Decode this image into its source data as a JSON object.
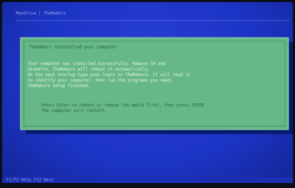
{
  "window": {
    "title": "Mandriva | TheMakers"
  },
  "colors": {
    "screen_background": "#1c34c4",
    "dialog_background": "#67b889",
    "dialog_text": "#215f40",
    "highlight_text": "#eef6e8"
  },
  "dialog": {
    "title": "TheMakers reinstalled your computer",
    "lines": [
      "Your computer was installed successfully. Remove CD and",
      "diskette, TheMakers will reboot it automatically.",
      "On the next startup type your login in TheMakers. It will read it",
      "to identify your computer, then run the programs you need.",
      "TheMakers setup finished."
    ],
    "hint_lines": [
      "Press Enter to reboot or remove the media first, then press ENTER",
      "The computer will restart."
    ]
  },
  "status_bar": {
    "text": "F1/F2 Help  F12 Next"
  }
}
